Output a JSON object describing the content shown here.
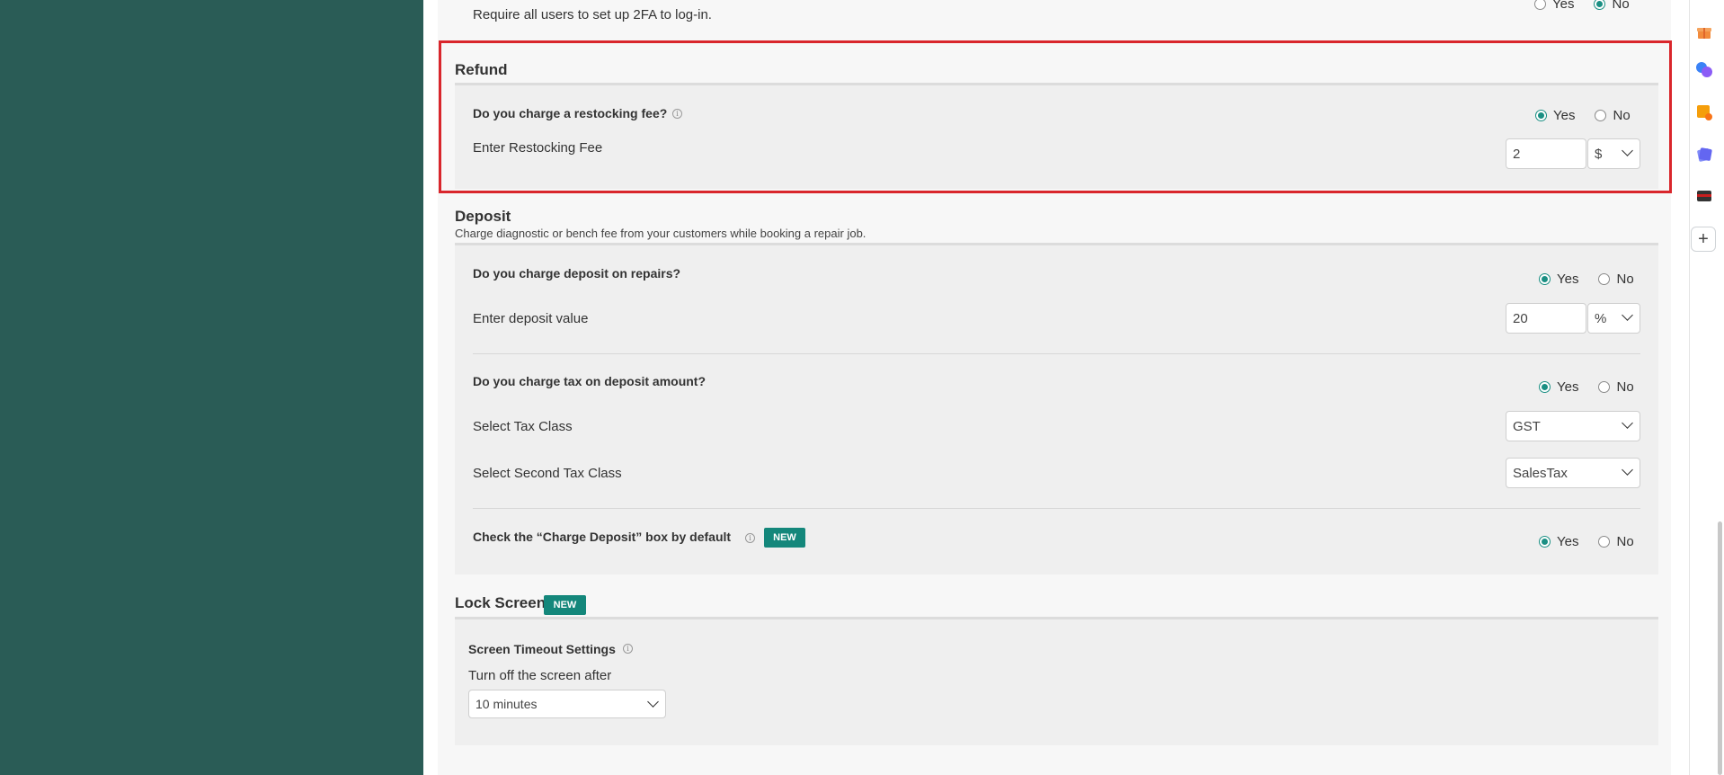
{
  "twofa": {
    "description": "Require all users to set up 2FA to log-in.",
    "yes_label": "Yes",
    "no_label": "No"
  },
  "refund": {
    "title": "Refund",
    "restocking_question": "Do you charge a restocking fee?",
    "yes_label": "Yes",
    "no_label": "No",
    "restocking_fee_label": "Enter Restocking Fee",
    "restocking_fee_value": "2",
    "restocking_fee_unit": "$"
  },
  "deposit": {
    "title": "Deposit",
    "description": "Charge diagnostic or bench fee from your customers while booking a repair job.",
    "charge_deposit_question": "Do you charge deposit on repairs?",
    "yes_label": "Yes",
    "no_label": "No",
    "deposit_value_label": "Enter deposit value",
    "deposit_value": "20",
    "deposit_unit": "%",
    "tax_question": "Do you charge tax on deposit amount?",
    "tax_class_label": "Select Tax Class",
    "tax_class_value": "GST",
    "second_tax_class_label": "Select Second Tax Class",
    "second_tax_class_value": "SalesTax",
    "charge_deposit_default_label": "Check the “Charge Deposit” box by default",
    "new_badge": "NEW"
  },
  "lock_screen": {
    "title": "Lock Screen",
    "new_badge": "NEW",
    "timeout_settings_label": "Screen Timeout Settings",
    "turn_off_label": "Turn off the screen after",
    "timeout_value": "10 minutes"
  },
  "colors": {
    "accent": "#14877b",
    "sidebar": "#2a5c56",
    "highlight": "#d9262c"
  },
  "rail_icons": [
    "gift-icon",
    "chat-bubbles-icon",
    "sticky-note-icon",
    "cards-icon",
    "wallet-icon",
    "plus-icon"
  ]
}
